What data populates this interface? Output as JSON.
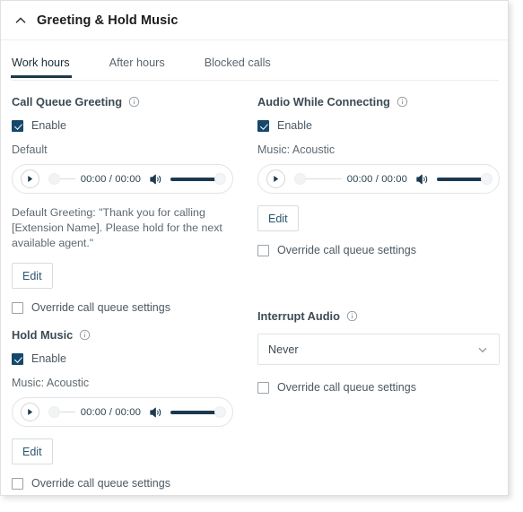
{
  "header": {
    "title": "Greeting & Hold Music",
    "collapse_icon": "chevron-up-icon"
  },
  "tabs": [
    {
      "label": "Work hours",
      "active": true
    },
    {
      "label": "After hours",
      "active": false
    },
    {
      "label": "Blocked calls",
      "active": false
    }
  ],
  "colors": {
    "accent": "#1b3a4b",
    "checkbox_checked": "#15486c",
    "link_text": "#2c5770",
    "body_text": "#5d6a73",
    "heading_text": "#3c4a54",
    "border": "#e1e3e5"
  },
  "sections": {
    "call_queue_greeting": {
      "heading": "Call Queue Greeting",
      "info_icon": "info-icon",
      "enable_label": "Enable",
      "enable_checked": true,
      "source_label": "Default",
      "player": {
        "play_icon": "play-icon",
        "time": "00:00 / 00:00",
        "speaker_icon": "volume-icon",
        "seek_position": 0,
        "volume_level": 100
      },
      "description": "Default Greeting: \"Thank you for calling [Extension Name]. Please hold for the next available agent.\"",
      "edit_label": "Edit",
      "override_label": "Override call queue settings",
      "override_checked": false
    },
    "hold_music": {
      "heading": "Hold Music",
      "info_icon": "info-icon",
      "enable_label": "Enable",
      "enable_checked": true,
      "source_label": "Music: Acoustic",
      "player": {
        "play_icon": "play-icon",
        "time": "00:00 / 00:00",
        "speaker_icon": "volume-icon",
        "seek_position": 0,
        "volume_level": 100
      },
      "edit_label": "Edit",
      "override_label": "Override call queue settings",
      "override_checked": false
    },
    "audio_while_connecting": {
      "heading": "Audio While Connecting",
      "info_icon": "info-icon",
      "enable_label": "Enable",
      "enable_checked": true,
      "source_label": "Music: Acoustic",
      "player": {
        "play_icon": "play-icon",
        "time": "00:00 / 00:00",
        "speaker_icon": "volume-icon",
        "seek_position": 0,
        "volume_level": 100
      },
      "edit_label": "Edit",
      "override_label": "Override call queue settings",
      "override_checked": false
    },
    "interrupt_audio": {
      "heading": "Interrupt Audio",
      "info_icon": "info-icon",
      "select_value": "Never",
      "select_icon": "chevron-down-icon",
      "override_label": "Override call queue settings",
      "override_checked": false
    }
  }
}
